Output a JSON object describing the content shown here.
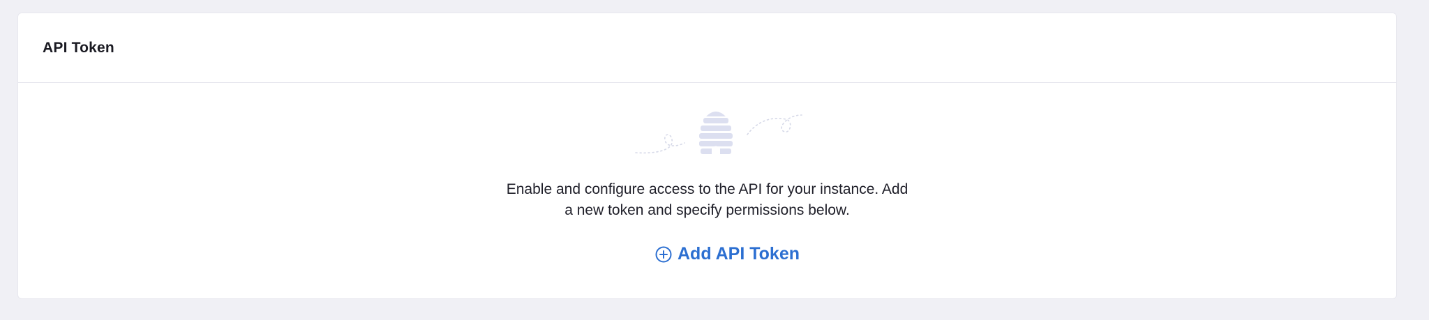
{
  "card": {
    "title": "API Token"
  },
  "empty_state": {
    "illustration": "beehive-icon",
    "description_line1": "Enable and configure access to the API for your instance. Add",
    "description_line2": "a new token and specify permissions below."
  },
  "actions": {
    "add_label": "Add API Token",
    "add_icon": "plus-circle-icon"
  },
  "colors": {
    "background": "#f0f0f5",
    "card": "#ffffff",
    "accent": "#2c6fd1",
    "illustration": "#dcdff0"
  }
}
